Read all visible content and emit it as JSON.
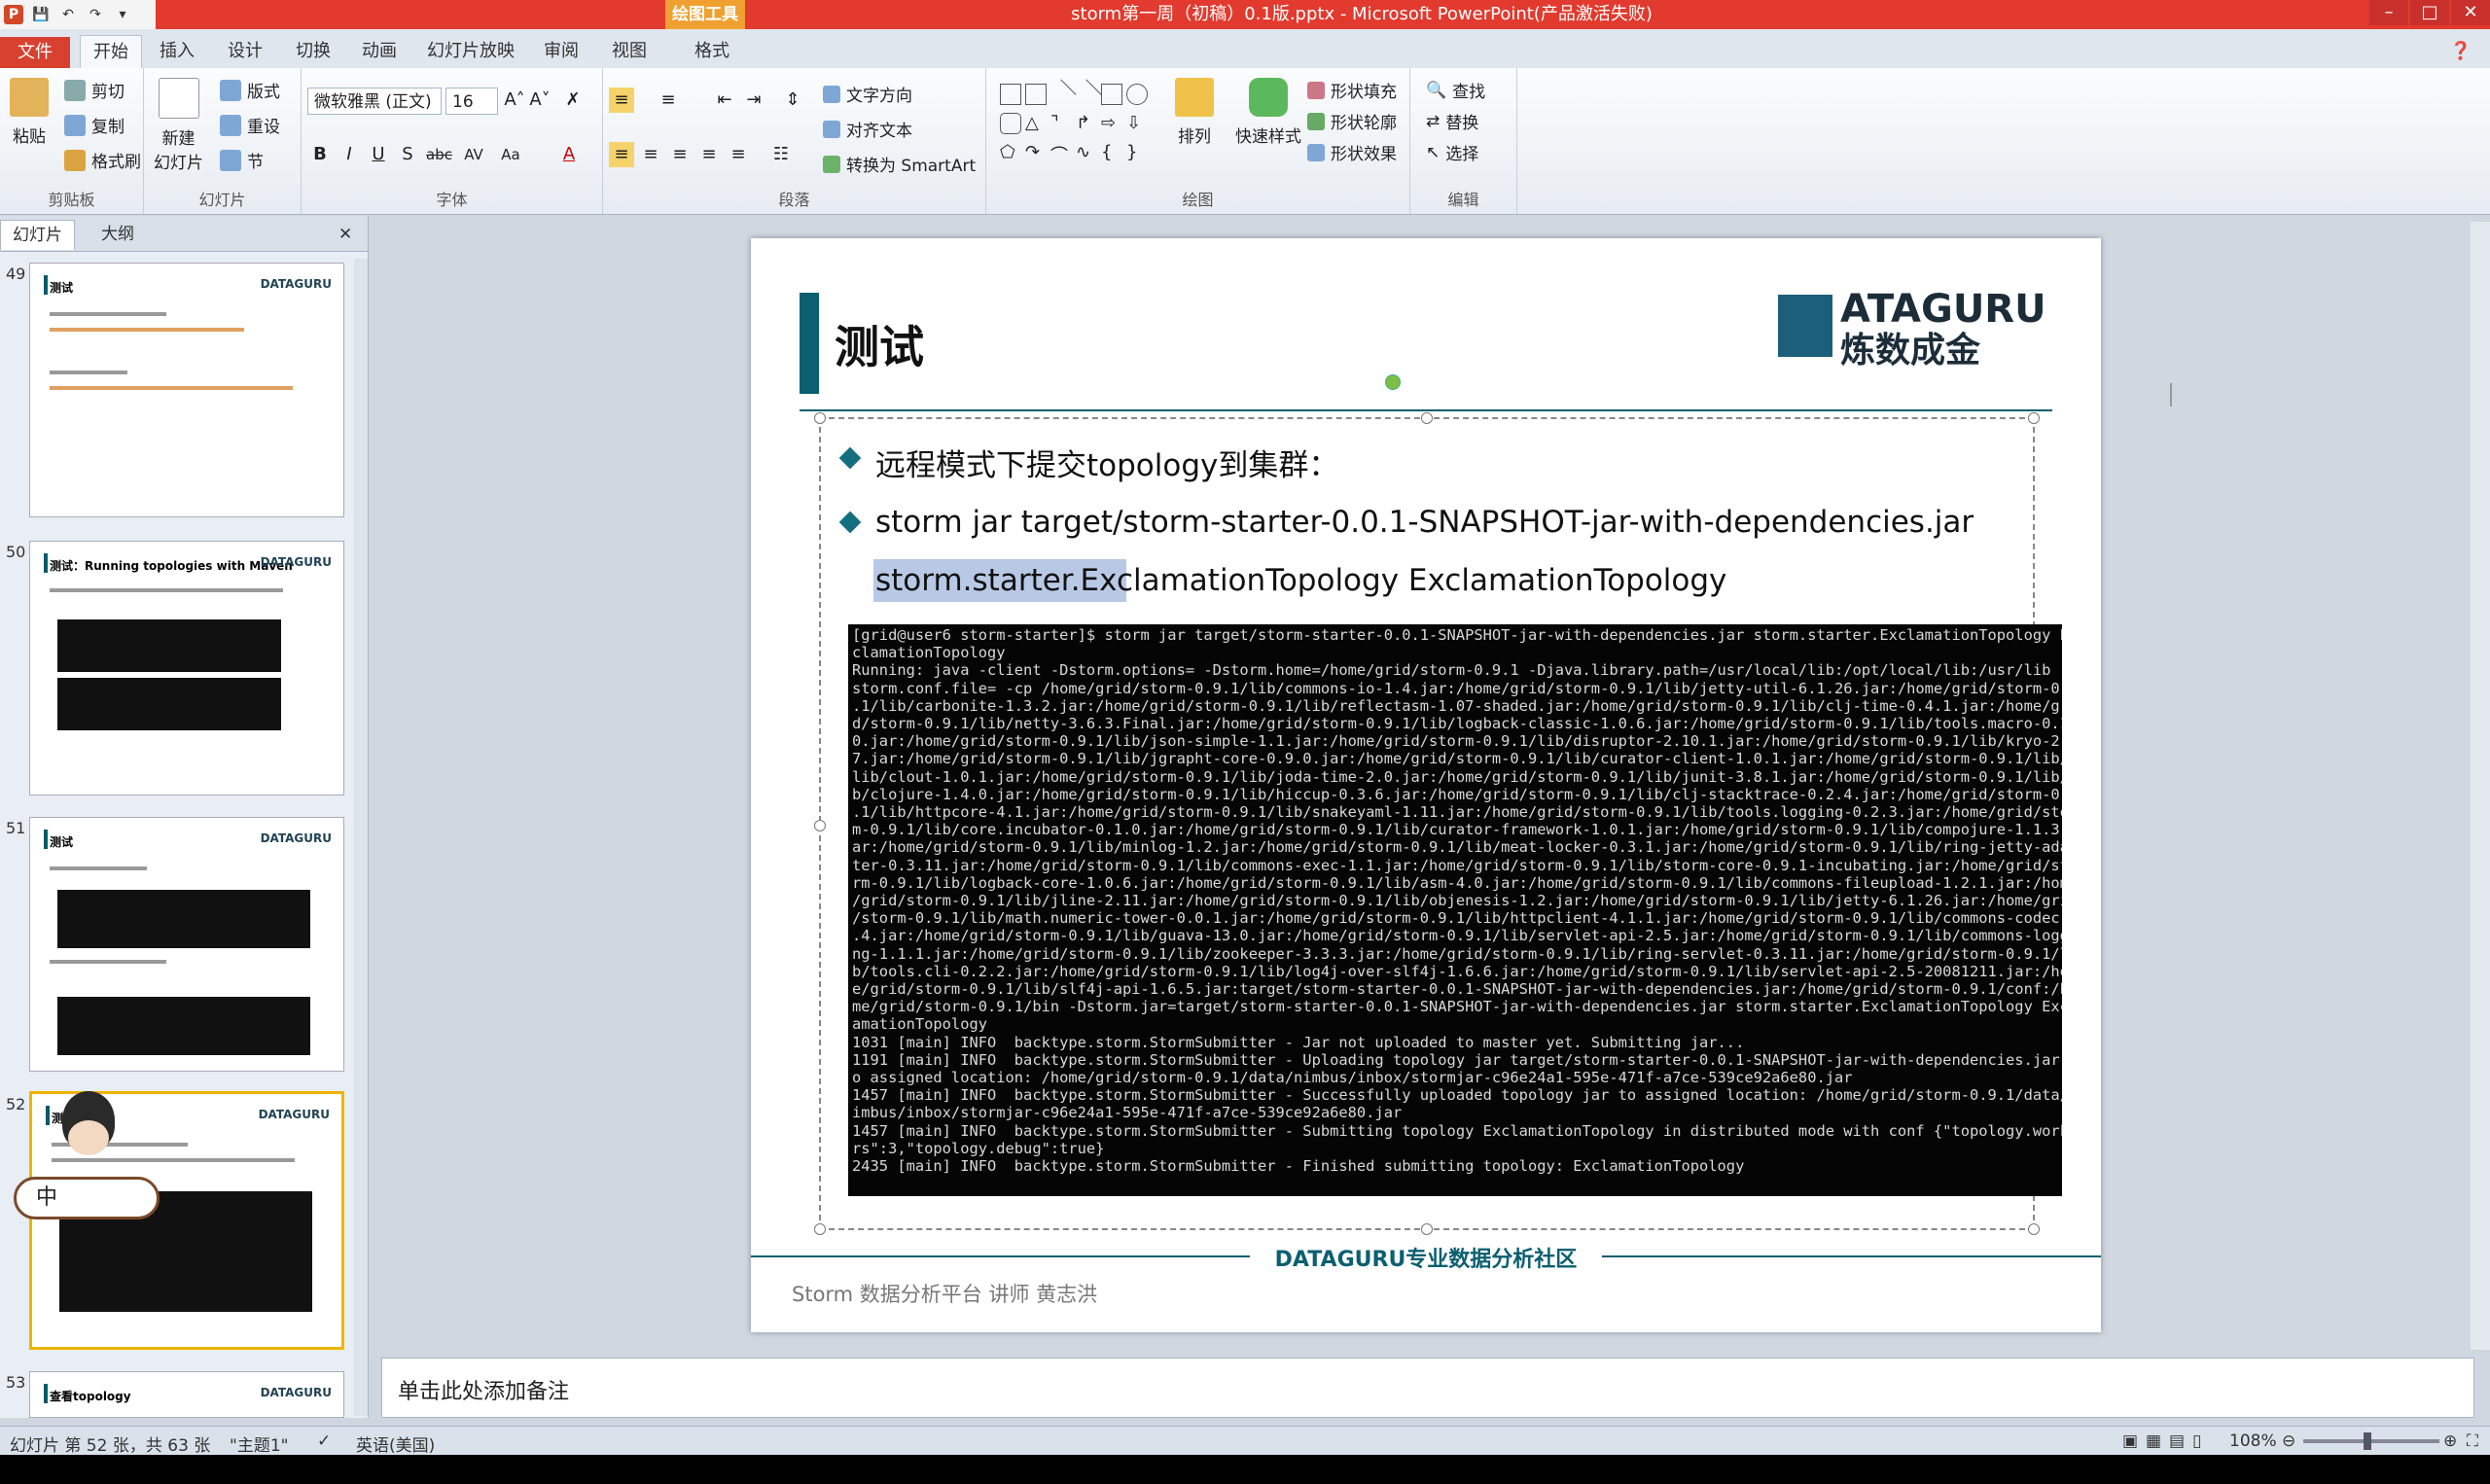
{
  "app": {
    "window_title": "storm第一周（初稿）0.1版.pptx - Microsoft PowerPoint(产品激活失败)",
    "context_tool": "绘图工具"
  },
  "tabs": [
    "文件",
    "开始",
    "插入",
    "设计",
    "切换",
    "动画",
    "幻灯片放映",
    "审阅",
    "视图",
    "格式"
  ],
  "ribbon": {
    "clipboard": {
      "paste": "粘贴",
      "cut": "剪切",
      "copy": "复制",
      "format_painter": "格式刷",
      "label": "剪贴板"
    },
    "slides": {
      "new_slide": "新建\n幻灯片",
      "layout": "版式",
      "reset": "重设",
      "section": "节",
      "label": "幻灯片"
    },
    "font": {
      "name": "微软雅黑 (正文)",
      "size": "16",
      "label": "字体"
    },
    "paragraph": {
      "text_direction": "文字方向",
      "align_text": "对齐文本",
      "smartart": "转换为 SmartArt",
      "label": "段落"
    },
    "drawing": {
      "arrange": "排列",
      "quick_styles": "快速样式",
      "shape_fill": "形状填充",
      "shape_outline": "形状轮廓",
      "shape_effects": "形状效果",
      "label": "绘图"
    },
    "editing": {
      "find": "查找",
      "replace": "替换",
      "select": "选择",
      "label": "编辑"
    }
  },
  "panel": {
    "tabs": [
      "幻灯片",
      "大纲"
    ],
    "thumbnails": [
      {
        "num": "49",
        "title": "测试"
      },
      {
        "num": "50",
        "title": "测试：Running topologies with Maven"
      },
      {
        "num": "51",
        "title": "测试"
      },
      {
        "num": "52",
        "title": "测试"
      },
      {
        "num": "53",
        "title": "查看topology"
      }
    ],
    "thumb_logo": "DATAGURU"
  },
  "ime": {
    "label": "中"
  },
  "slide": {
    "title": "测试",
    "logo_en": "ATAGURU",
    "logo_cn": "炼数成金",
    "bullets": [
      "远程模式下提交topology到集群：",
      "storm jar target/storm-starter-0.0.1-SNAPSHOT-jar-with-dependencies.jar"
    ],
    "bullet2_line2": "storm.starter.ExclamationTopology   ExclamationTopology",
    "terminal": "[grid@user6 storm-starter]$ storm jar target/storm-starter-0.0.1-SNAPSHOT-jar-with-dependencies.jar storm.starter.ExclamationTopology Ex\nclamationTopology\nRunning: java -client -Dstorm.options= -Dstorm.home=/home/grid/storm-0.9.1 -Djava.library.path=/usr/local/lib:/opt/local/lib:/usr/lib -D\nstorm.conf.file= -cp /home/grid/storm-0.9.1/lib/commons-io-1.4.jar:/home/grid/storm-0.9.1/lib/jetty-util-6.1.26.jar:/home/grid/storm-0.9\n.1/lib/carbonite-1.3.2.jar:/home/grid/storm-0.9.1/lib/reflectasm-1.07-shaded.jar:/home/grid/storm-0.9.1/lib/clj-time-0.4.1.jar:/home/gri\nd/storm-0.9.1/lib/netty-3.6.3.Final.jar:/home/grid/storm-0.9.1/lib/logback-classic-1.0.6.jar:/home/grid/storm-0.9.1/lib/tools.macro-0.1.\n0.jar:/home/grid/storm-0.9.1/lib/json-simple-1.1.jar:/home/grid/storm-0.9.1/lib/disruptor-2.10.1.jar:/home/grid/storm-0.9.1/lib/kryo-2.1\n7.jar:/home/grid/storm-0.9.1/lib/jgrapht-core-0.9.0.jar:/home/grid/storm-0.9.1/lib/curator-client-1.0.1.jar:/home/grid/storm-0.9.1/lib/r\nlib/clout-1.0.1.jar:/home/grid/storm-0.9.1/lib/joda-time-2.0.jar:/home/grid/storm-0.9.1/lib/junit-3.8.1.jar:/home/grid/storm-0.9.1/lib/c\nb/clojure-1.4.0.jar:/home/grid/storm-0.9.1/lib/hiccup-0.3.6.jar:/home/grid/storm-0.9.1/lib/clj-stacktrace-0.2.4.jar:/home/grid/storm-0.9\n.1/lib/httpcore-4.1.jar:/home/grid/storm-0.9.1/lib/snakeyaml-1.11.jar:/home/grid/storm-0.9.1/lib/tools.logging-0.2.3.jar:/home/grid/stor\nm-0.9.1/lib/core.incubator-0.1.0.jar:/home/grid/storm-0.9.1/lib/curator-framework-1.0.1.jar:/home/grid/storm-0.9.1/lib/compojure-1.1.3.j\nar:/home/grid/storm-0.9.1/lib/minlog-1.2.jar:/home/grid/storm-0.9.1/lib/meat-locker-0.3.1.jar:/home/grid/storm-0.9.1/lib/ring-jetty-adap\nter-0.3.11.jar:/home/grid/storm-0.9.1/lib/commons-exec-1.1.jar:/home/grid/storm-0.9.1/lib/storm-core-0.9.1-incubating.jar:/home/grid/sto\nrm-0.9.1/lib/logback-core-1.0.6.jar:/home/grid/storm-0.9.1/lib/asm-4.0.jar:/home/grid/storm-0.9.1/lib/commons-fileupload-1.2.1.jar:/home\n/grid/storm-0.9.1/lib/jline-2.11.jar:/home/grid/storm-0.9.1/lib/objenesis-1.2.jar:/home/grid/storm-0.9.1/lib/jetty-6.1.26.jar:/home/grid\n/storm-0.9.1/lib/math.numeric-tower-0.0.1.jar:/home/grid/storm-0.9.1/lib/httpclient-4.1.1.jar:/home/grid/storm-0.9.1/lib/commons-codec-1\n.4.jar:/home/grid/storm-0.9.1/lib/guava-13.0.jar:/home/grid/storm-0.9.1/lib/servlet-api-2.5.jar:/home/grid/storm-0.9.1/lib/commons-loggi\nng-1.1.1.jar:/home/grid/storm-0.9.1/lib/zookeeper-3.3.3.jar:/home/grid/storm-0.9.1/lib/ring-servlet-0.3.11.jar:/home/grid/storm-0.9.1/li\nb/tools.cli-0.2.2.jar:/home/grid/storm-0.9.1/lib/log4j-over-slf4j-1.6.6.jar:/home/grid/storm-0.9.1/lib/servlet-api-2.5-20081211.jar:/hom\ne/grid/storm-0.9.1/lib/slf4j-api-1.6.5.jar:target/storm-starter-0.0.1-SNAPSHOT-jar-with-dependencies.jar:/home/grid/storm-0.9.1/conf:/ho\nme/grid/storm-0.9.1/bin -Dstorm.jar=target/storm-starter-0.0.1-SNAPSHOT-jar-with-dependencies.jar storm.starter.ExclamationTopology Excl\namationTopology\n1031 [main] INFO  backtype.storm.StormSubmitter - Jar not uploaded to master yet. Submitting jar...\n1191 [main] INFO  backtype.storm.StormSubmitter - Uploading topology jar target/storm-starter-0.0.1-SNAPSHOT-jar-with-dependencies.jar t\no assigned location: /home/grid/storm-0.9.1/data/nimbus/inbox/stormjar-c96e24a1-595e-471f-a7ce-539ce92a6e80.jar\n1457 [main] INFO  backtype.storm.StormSubmitter - Successfully uploaded topology jar to assigned location: /home/grid/storm-0.9.1/data/n\nimbus/inbox/stormjar-c96e24a1-595e-471f-a7ce-539ce92a6e80.jar\n1457 [main] INFO  backtype.storm.StormSubmitter - Submitting topology ExclamationTopology in distributed mode with conf {\"topology.worke\nrs\":3,\"topology.debug\":true}\n2435 [main] INFO  backtype.storm.StormSubmitter - Finished submitting topology: ExclamationTopology",
    "footer_center": "DATAGURU专业数据分析社区",
    "footer_left": "Storm 数据分析平台 讲师  黄志洪"
  },
  "notes_placeholder": "单击此处添加备注",
  "status": {
    "slide_info": "幻灯片 第 52 张，共 63 张",
    "theme": "\"主题1\"",
    "language": "英语(美国)",
    "zoom": "108%"
  }
}
